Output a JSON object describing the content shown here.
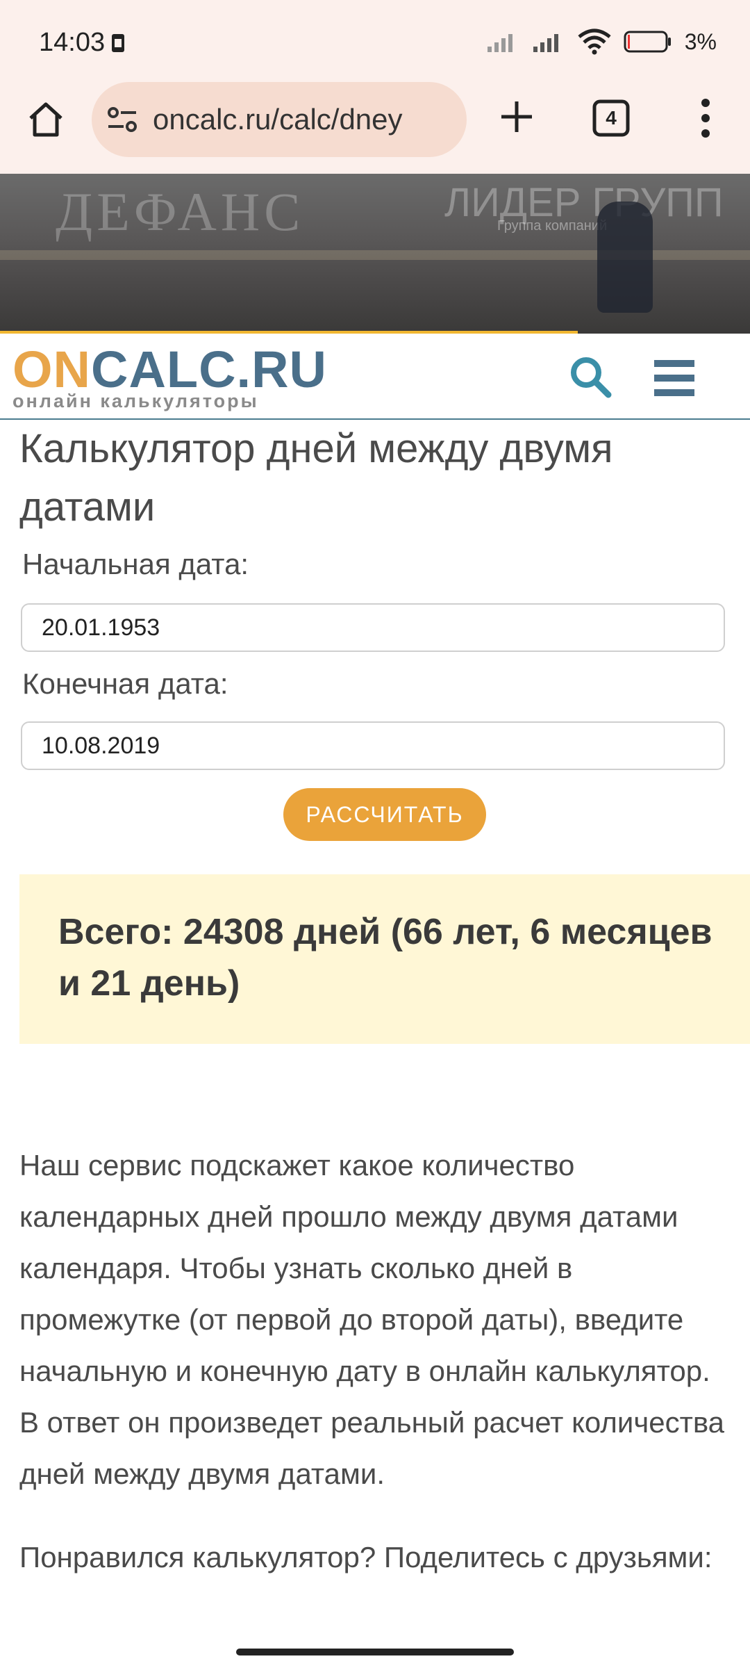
{
  "status_bar": {
    "time": "14:03",
    "battery_pct": "3%"
  },
  "browser": {
    "url": "oncalc.ru/calc/dney",
    "tab_count": "4"
  },
  "banner": {
    "text_left": "ДЕФАНС",
    "text_right": "ЛИДЕР ГРУПП",
    "text_sub": "Группа компаний",
    "progress": 0.77
  },
  "site": {
    "logo_on": "ON",
    "logo_calc": "CALC.RU",
    "logo_sub": "онлайн калькуляторы"
  },
  "main": {
    "title": "Калькулятор дней между двумя датами",
    "start_label": "Начальная дата:",
    "start_value": "20.01.1953",
    "end_label": "Конечная дата:",
    "end_value": "10.08.2019",
    "calc_button": "РАССЧИТАТЬ",
    "result": "Всего: 24308 дней (66 лет, 6 месяцев и 21 день)",
    "description": "Наш сервис подскажет какое количество календарных дней прошло между двумя датами календаря. Чтобы узнать сколько дней в промежутке (от первой до второй даты), введите начальную и конечную дату в онлайн калькулятор. В ответ он произведет реальный расчет количества дней между двумя датами.",
    "share_text": "Понравился калькулятор? Поделитесь с друзьями:"
  },
  "colors": {
    "accent_orange": "#eaa33a",
    "logo_blue": "#4a6f8a",
    "result_bg": "#fff7d6",
    "chrome_bg": "#fcf0ec"
  }
}
